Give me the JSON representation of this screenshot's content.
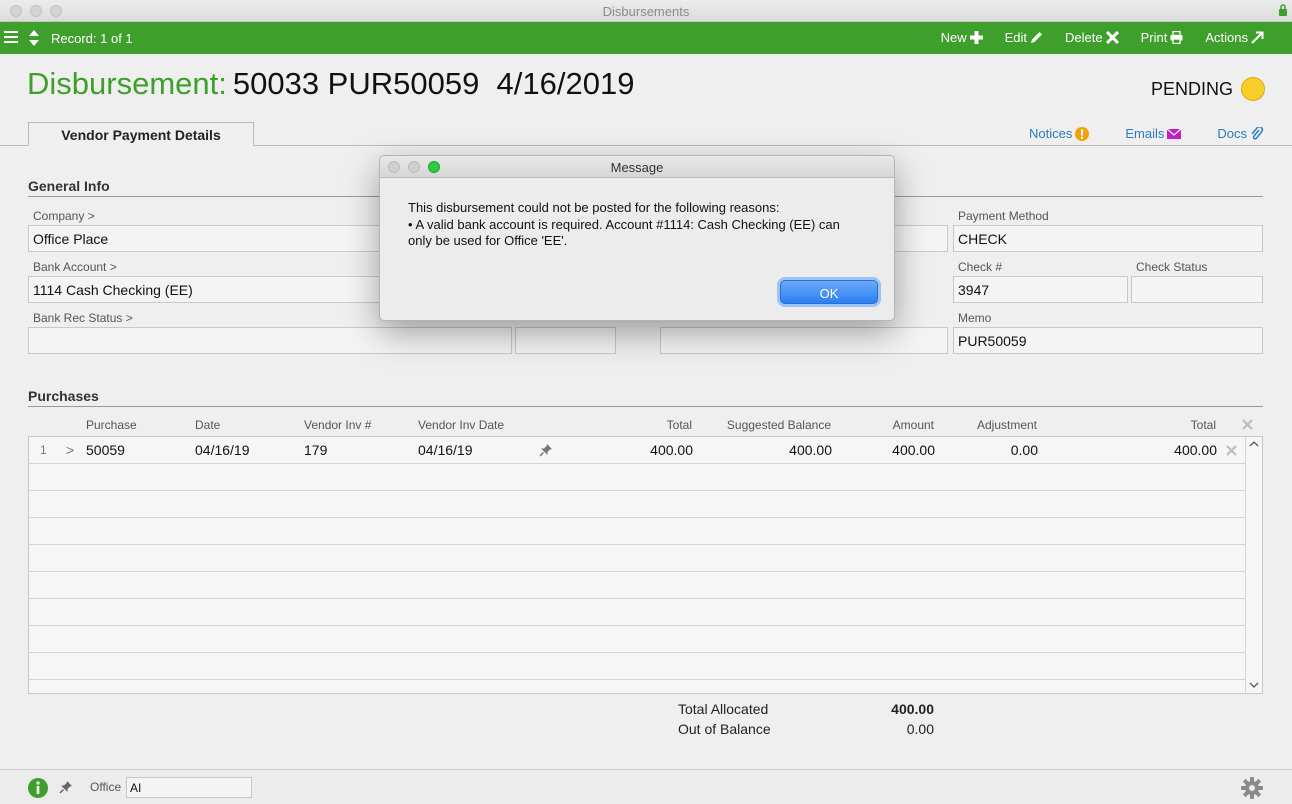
{
  "window": {
    "title": "Disbursements"
  },
  "toolbar": {
    "record": "Record: 1 of 1",
    "new": "New",
    "edit": "Edit",
    "delete": "Delete",
    "print": "Print",
    "actions": "Actions"
  },
  "header": {
    "label": "Disbursement:",
    "value": "50033 PUR50059  4/16/2019",
    "status": "PENDING",
    "status_color": "#f7cd2a"
  },
  "tabs": {
    "active": "Vendor Payment Details"
  },
  "links": {
    "notices": "Notices",
    "emails": "Emails",
    "docs": "Docs"
  },
  "general": {
    "heading": "General Info",
    "company_label": "Company >",
    "company": "Office Place",
    "bank_account_label": "Bank Account >",
    "bank_account": "1114 Cash Checking (EE)",
    "bank_rec_label": "Bank Rec Status >",
    "bank_rec": "",
    "payment_method_label": "Payment Method",
    "payment_method": "CHECK",
    "check_no_label": "Check #",
    "check_no": "3947",
    "check_status_label": "Check Status",
    "check_status": "",
    "memo_label": "Memo",
    "memo": "PUR50059"
  },
  "purchases": {
    "heading": "Purchases",
    "columns": [
      "Purchase",
      "Date",
      "Vendor Inv #",
      "Vendor Inv Date",
      "Total",
      "Suggested Balance",
      "Amount",
      "Adjustment",
      "Total"
    ],
    "rows": [
      {
        "num": "1",
        "expand": ">",
        "purchase": "50059",
        "date": "04/16/19",
        "vendor_inv": "179",
        "vendor_inv_date": "04/16/19",
        "total": "400.00",
        "suggested": "400.00",
        "amount": "400.00",
        "adjustment": "0.00",
        "total2": "400.00"
      }
    ]
  },
  "totals": {
    "allocated_label": "Total Allocated",
    "allocated": "400.00",
    "out_label": "Out of Balance",
    "out": "0.00"
  },
  "footer": {
    "office_label": "Office",
    "office": "AI"
  },
  "dialog": {
    "title": "Message",
    "line1": "This disbursement could not be posted for the following reasons:",
    "line2": "• A valid bank account is required. Account #1114: Cash Checking (EE) can",
    "line3": "only be used for Office 'EE'.",
    "ok": "OK"
  },
  "colors": {
    "accent": "#3f9f2c",
    "link": "#2a7bc0",
    "primary_button": "#2b7ff3"
  }
}
